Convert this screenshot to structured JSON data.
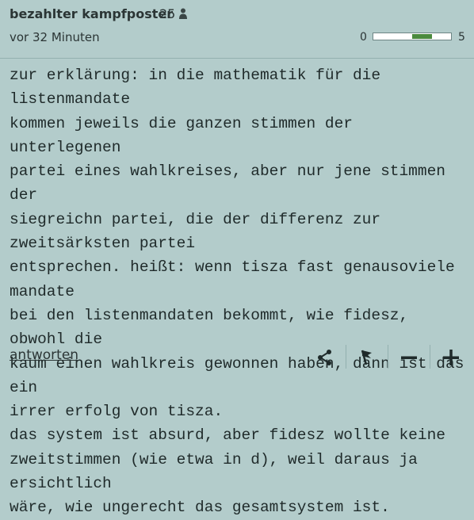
{
  "post": {
    "username": "bezahlter kampfposter",
    "follower_count": "25",
    "timestamp": "vor 32 Minuten",
    "rating": {
      "min_label": "0",
      "max_label": "5",
      "fill_start": 0.5,
      "fill_end": 0.75
    },
    "body": "zur erklärung: in die mathematik für die listenmandate\nkommen jeweils die ganzen stimmen der unterlegenen\npartei eines wahlkreises, aber nur jene stimmen der\nsiegreichn partei, die der differenz zur zweitsärksten partei\nentsprechen. heißt: wenn tisza fast genausoviele mandate\nbei den listenmandaten bekommt, wie fidesz, obwohl die\nkaum einen wahlkreis gewonnen haben, dann ist das ein\nirrer erfolg von tisza.\ndas system ist absurd, aber fidesz wollte keine\nzweitstimmen (wie etwa in d), weil daraus ja ersichtlich\nwäre, wie ungerecht das gesamtsystem ist."
  },
  "footer": {
    "reply_label": "antworten",
    "actions": [
      "share-icon",
      "flag-icon",
      "minus-icon",
      "plus-icon"
    ]
  },
  "colors": {
    "background": "#b3cccb",
    "rating_fill": "#4b8a3e"
  }
}
